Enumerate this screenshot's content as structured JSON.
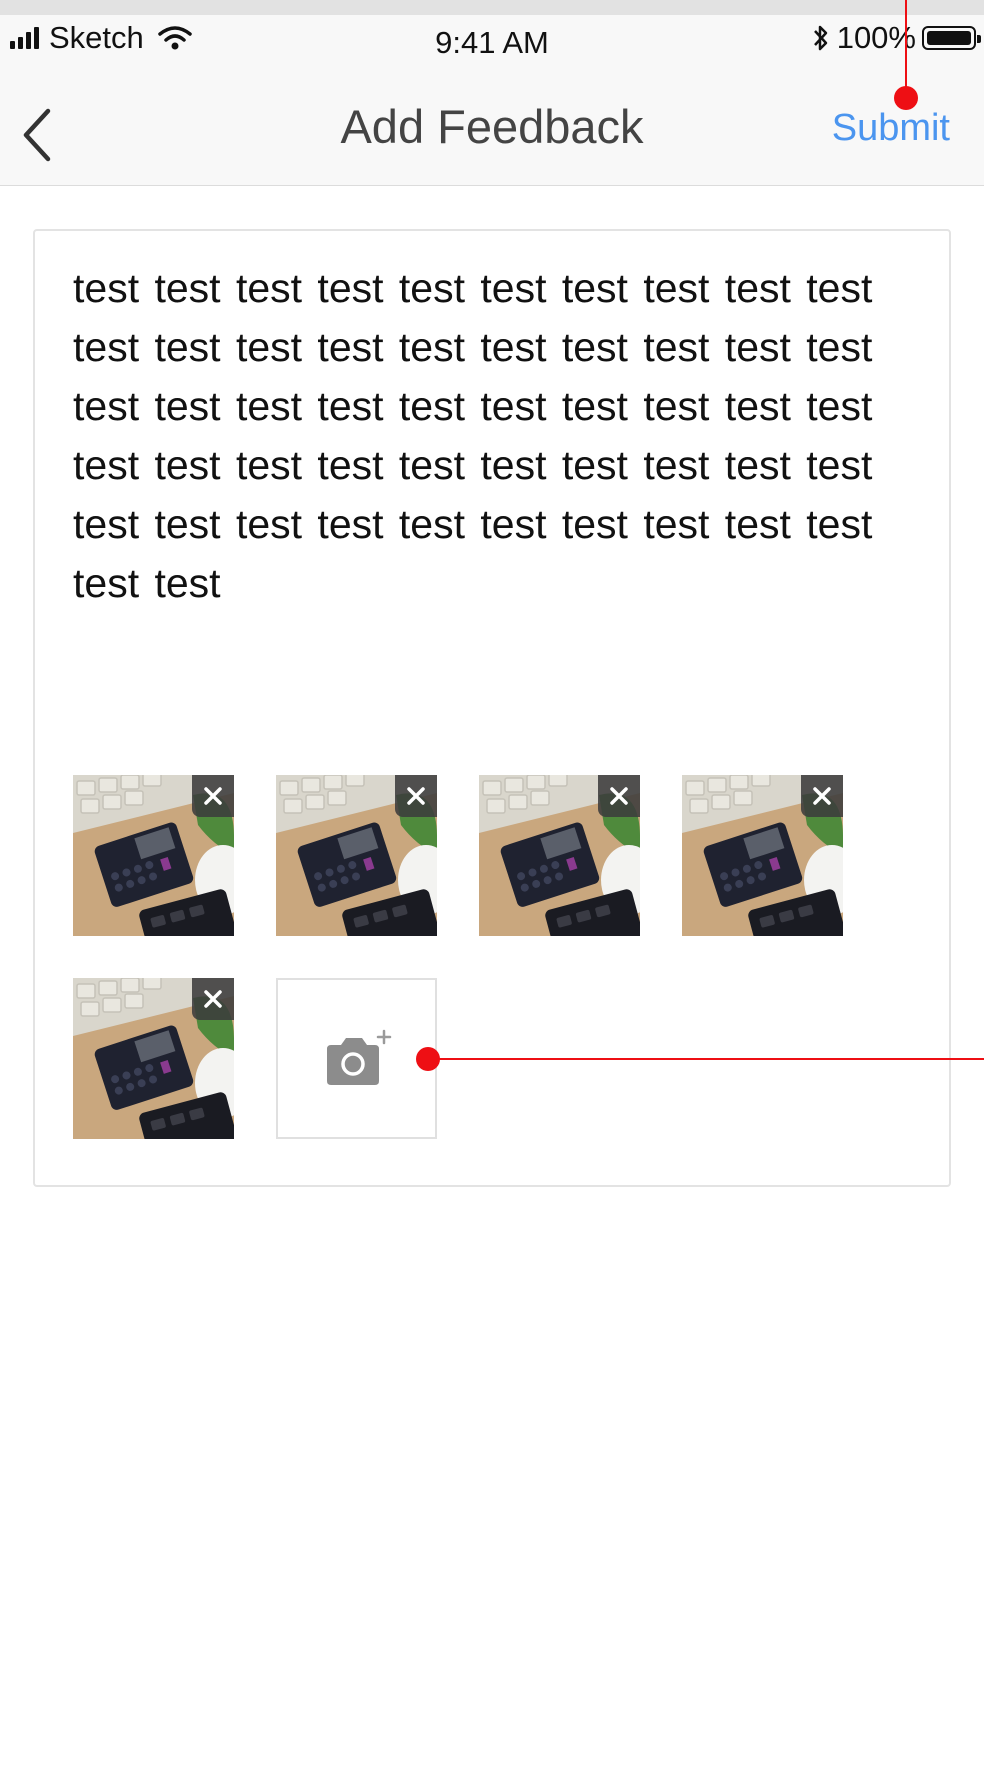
{
  "status_bar": {
    "carrier": "Sketch",
    "time": "9:41 AM",
    "battery_percent": "100%",
    "signal_bars": 4,
    "icons": [
      "signal-icon",
      "wifi-icon",
      "bluetooth-icon",
      "battery-icon"
    ]
  },
  "nav": {
    "back_icon": "chevron-left-icon",
    "title": "Add Feedback",
    "submit_label": "Submit"
  },
  "feedback": {
    "text": "test test test test test test test test test test test test test test test test test test test test test test test test test test test test test test test test test test test test test test test test test test test test test test test test test test test test"
  },
  "photos": {
    "items": [
      {
        "remove_icon": "close-icon"
      },
      {
        "remove_icon": "close-icon"
      },
      {
        "remove_icon": "close-icon"
      },
      {
        "remove_icon": "close-icon"
      },
      {
        "remove_icon": "close-icon"
      }
    ],
    "add_icon": "camera-add-icon"
  },
  "colors": {
    "accent": "#4b95ef",
    "annotation": "#ee0f14",
    "nav_background": "#f8f8f8",
    "card_border": "#e3e3e3"
  }
}
